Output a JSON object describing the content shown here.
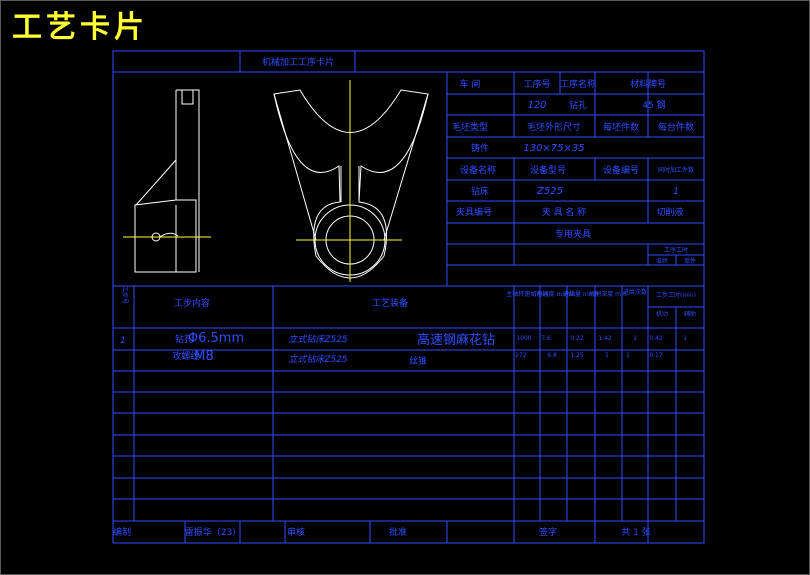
{
  "title": "工艺卡片",
  "header": {
    "card_name": "机械加工工序卡片"
  },
  "info": {
    "workshop_label": "车 间",
    "op_no_label": "工序号",
    "op_name_label": "工序名称",
    "material_label": "材料牌号",
    "op_no": "120",
    "op_name": "钻孔",
    "material": "45 钢",
    "blank_type_label": "毛坯类型",
    "blank_size_label": "毛坯外形尺寸",
    "blank_count_label": "每坯件数",
    "per_unit_label": "每台件数",
    "blank_type": "铸件",
    "blank_size": "130×75×35",
    "equip_name_label": "设备名称",
    "equip_model_label": "设备型号",
    "equip_no_label": "设备编号",
    "parallel_label": "同时加工件数",
    "equip_name": "钻床",
    "equip_model": "Z525",
    "parallel": "1",
    "fixture_no_label": "夹具编号",
    "fixture_name_label": "夹 具 名 称",
    "coolant_label": "切削液",
    "fixture_name": "专用夹具",
    "time_label": "工序工时",
    "time_a": "准终",
    "time_b": "单件"
  },
  "steps_header": {
    "step_no": "工步号",
    "step_content": "工步内容",
    "equipment": "工艺装备",
    "spindle_speed": "主轴转速 r/min",
    "cutting_speed": "切削速度 m/min",
    "feed": "进给量 mm/r",
    "depth": "切削深度 mm",
    "passes": "进给次数",
    "hours": "工步工时(min)",
    "machine": "机动",
    "aux": "辅助"
  },
  "steps": [
    {
      "no": "1",
      "content_a": "钻孔",
      "overlay_a": "Φ6.5mm",
      "content_b": "攻螺纹",
      "overlay_b": "M8",
      "equip_a": "立式钻床Z525",
      "equip_b": "立式钻床Z525",
      "tool": "高速钢麻花钻",
      "tool_b": "丝锥",
      "r1": [
        "1000",
        "7.6",
        "0.22",
        "1.42",
        "1",
        "0.42",
        "1"
      ],
      "r2": [
        "272",
        "6.8",
        "1.25",
        "1",
        "1",
        "0.17",
        ""
      ]
    }
  ],
  "footer": {
    "design": "编制",
    "name": "雷振华（23）",
    "check": "审核",
    "approve": "批准",
    "sign": "签字",
    "count": "共 1 张"
  }
}
